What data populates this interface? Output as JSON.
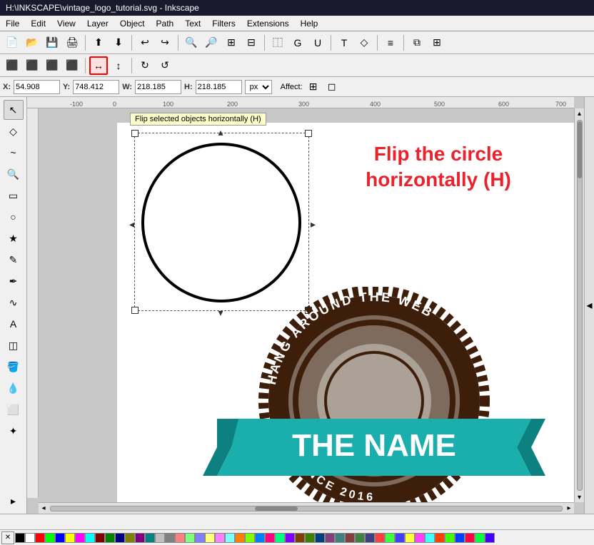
{
  "titlebar": {
    "text": "H:\\INKSCAPE\\vintage_logo_tutorial.svg - Inkscape"
  },
  "menubar": {
    "items": [
      "File",
      "Edit",
      "View",
      "Layer",
      "Object",
      "Path",
      "Text",
      "Filters",
      "Extensions",
      "Help"
    ]
  },
  "toolbar1": {
    "buttons": [
      {
        "name": "new",
        "icon": "📄"
      },
      {
        "name": "open",
        "icon": "📂"
      },
      {
        "name": "save",
        "icon": "💾"
      },
      {
        "name": "print",
        "icon": "🖨"
      },
      {
        "name": "sep1",
        "icon": "|"
      },
      {
        "name": "import",
        "icon": "⬆"
      },
      {
        "name": "export",
        "icon": "⬇"
      },
      {
        "name": "sep2",
        "icon": "|"
      },
      {
        "name": "undo",
        "icon": "↩"
      },
      {
        "name": "redo",
        "icon": "↪"
      },
      {
        "name": "sep3",
        "icon": "|"
      },
      {
        "name": "zoom-in",
        "icon": "🔍"
      },
      {
        "name": "zoom-out",
        "icon": "🔎"
      },
      {
        "name": "zoom-fit",
        "icon": "⊞"
      },
      {
        "name": "zoom-page",
        "icon": "⊟"
      },
      {
        "name": "sep4",
        "icon": "|"
      },
      {
        "name": "duplicate",
        "icon": "⿰"
      },
      {
        "name": "group",
        "icon": "G"
      },
      {
        "name": "ungroup",
        "icon": "U"
      },
      {
        "name": "sep5",
        "icon": "|"
      },
      {
        "name": "text-tool-tb",
        "icon": "T"
      },
      {
        "name": "node-tool-tb",
        "icon": "◇"
      },
      {
        "name": "sep6",
        "icon": "|"
      },
      {
        "name": "align",
        "icon": "≡"
      },
      {
        "name": "sep7",
        "icon": "|"
      },
      {
        "name": "more1",
        "icon": "⧉"
      },
      {
        "name": "more2",
        "icon": "⊞"
      }
    ]
  },
  "toolbar2": {
    "flip_h_label": "Flip selected objects horizontally (H)",
    "buttons": [
      {
        "name": "align-left",
        "icon": "⬛"
      },
      {
        "name": "align-center",
        "icon": "⬛"
      },
      {
        "name": "align-right",
        "icon": "⬛"
      },
      {
        "name": "sep",
        "icon": "|"
      },
      {
        "name": "flip-h",
        "icon": "↔",
        "active": true
      },
      {
        "name": "flip-v",
        "icon": "↕"
      },
      {
        "name": "sep2",
        "icon": "|"
      },
      {
        "name": "rotate-cw",
        "icon": "↻"
      },
      {
        "name": "rotate-ccw",
        "icon": "↺"
      }
    ]
  },
  "coords": {
    "x_label": "X:",
    "x_value": "54.908",
    "y_label": "Y:",
    "y_value": "748.412",
    "w_label": "W:",
    "w_value": "218.185",
    "h_label": "H:",
    "h_value": "218.185",
    "unit": "px",
    "affect_label": "Affect:"
  },
  "tools": [
    {
      "name": "select",
      "icon": "↖"
    },
    {
      "name": "node",
      "icon": "◇"
    },
    {
      "name": "tweak",
      "icon": "~"
    },
    {
      "name": "zoom",
      "icon": "🔍"
    },
    {
      "name": "rect",
      "icon": "▭"
    },
    {
      "name": "ellipse",
      "icon": "○"
    },
    {
      "name": "star",
      "icon": "★"
    },
    {
      "name": "pencil",
      "icon": "✎"
    },
    {
      "name": "pen",
      "icon": "✒"
    },
    {
      "name": "calligraphy",
      "icon": "𝒸"
    },
    {
      "name": "text",
      "icon": "A"
    },
    {
      "name": "gradient",
      "icon": "◫"
    },
    {
      "name": "paint-bucket",
      "icon": "🪣"
    },
    {
      "name": "eyedropper",
      "icon": "💉"
    },
    {
      "name": "eraser",
      "icon": "⬜"
    },
    {
      "name": "spray",
      "icon": "✦"
    }
  ],
  "canvas": {
    "tooltip": "Flip selected objects horizontally (H)",
    "instruction_line1": "Flip the circle",
    "instruction_line2": "horizontally (H)"
  },
  "logo": {
    "outer_text": "HANG AROUND THE WEB",
    "bottom_text": "SINCE 2016",
    "banner_text": "THE NAME",
    "colors": {
      "dark_brown": "#3d1e0a",
      "teal": "#1aaeac",
      "light_gray": "#c0b8b0"
    }
  },
  "statusbar": {
    "text": ""
  },
  "palette_colors": [
    "#000000",
    "#ffffff",
    "#ff0000",
    "#00ff00",
    "#0000ff",
    "#ffff00",
    "#ff00ff",
    "#00ffff",
    "#800000",
    "#008000",
    "#000080",
    "#808000",
    "#800080",
    "#008080",
    "#c0c0c0",
    "#808080",
    "#ff8080",
    "#80ff80",
    "#8080ff",
    "#ffff80",
    "#ff80ff",
    "#80ffff",
    "#ff8000",
    "#80ff00",
    "#0080ff",
    "#ff0080",
    "#00ff80",
    "#8000ff",
    "#804000",
    "#408000",
    "#004080",
    "#804080",
    "#408080",
    "#804040",
    "#408040",
    "#404080",
    "#ff4040",
    "#40ff40",
    "#4040ff",
    "#ffff40",
    "#ff40ff",
    "#40ffff",
    "#ff4000",
    "#40ff00",
    "#0040ff",
    "#ff0040",
    "#00ff40",
    "#4000ff"
  ]
}
